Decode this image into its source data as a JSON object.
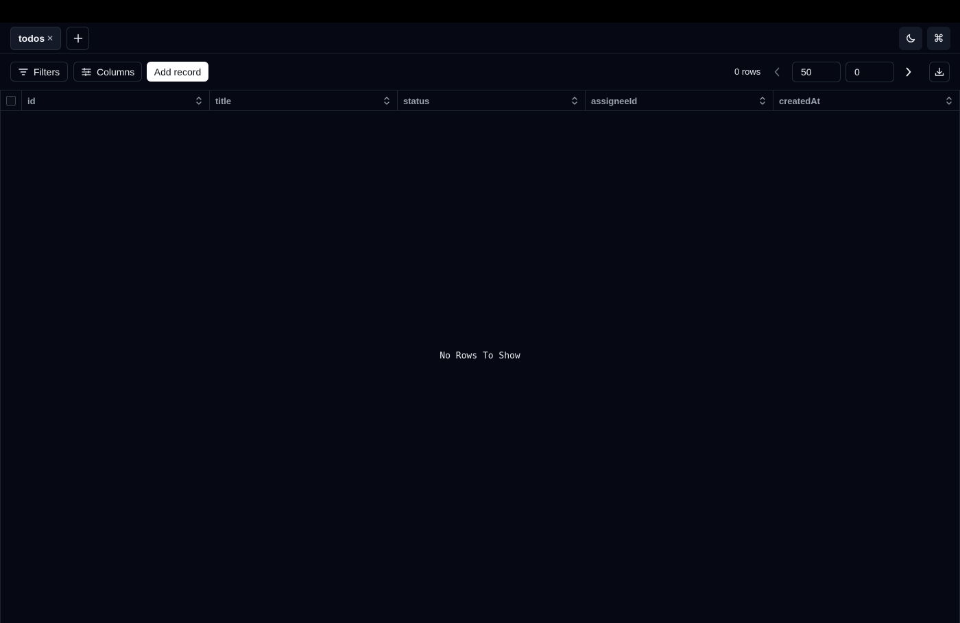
{
  "tabs": [
    {
      "label": "todos",
      "close_icon": "close-icon"
    }
  ],
  "tabbar": {
    "add_tab_icon": "plus-icon",
    "theme_icon": "moon-icon",
    "command_icon": "command-icon"
  },
  "toolbar": {
    "filters_label": "Filters",
    "columns_label": "Columns",
    "add_record_label": "Add record",
    "rows_count": "0 rows",
    "page_size": "50",
    "offset": "0"
  },
  "grid": {
    "columns": [
      "id",
      "title",
      "status",
      "assigneeId",
      "createdAt"
    ],
    "empty_message": "No Rows To Show"
  },
  "colors": {
    "background": "#060913",
    "accent_button": "#ffffff",
    "border": "#262d3b"
  }
}
